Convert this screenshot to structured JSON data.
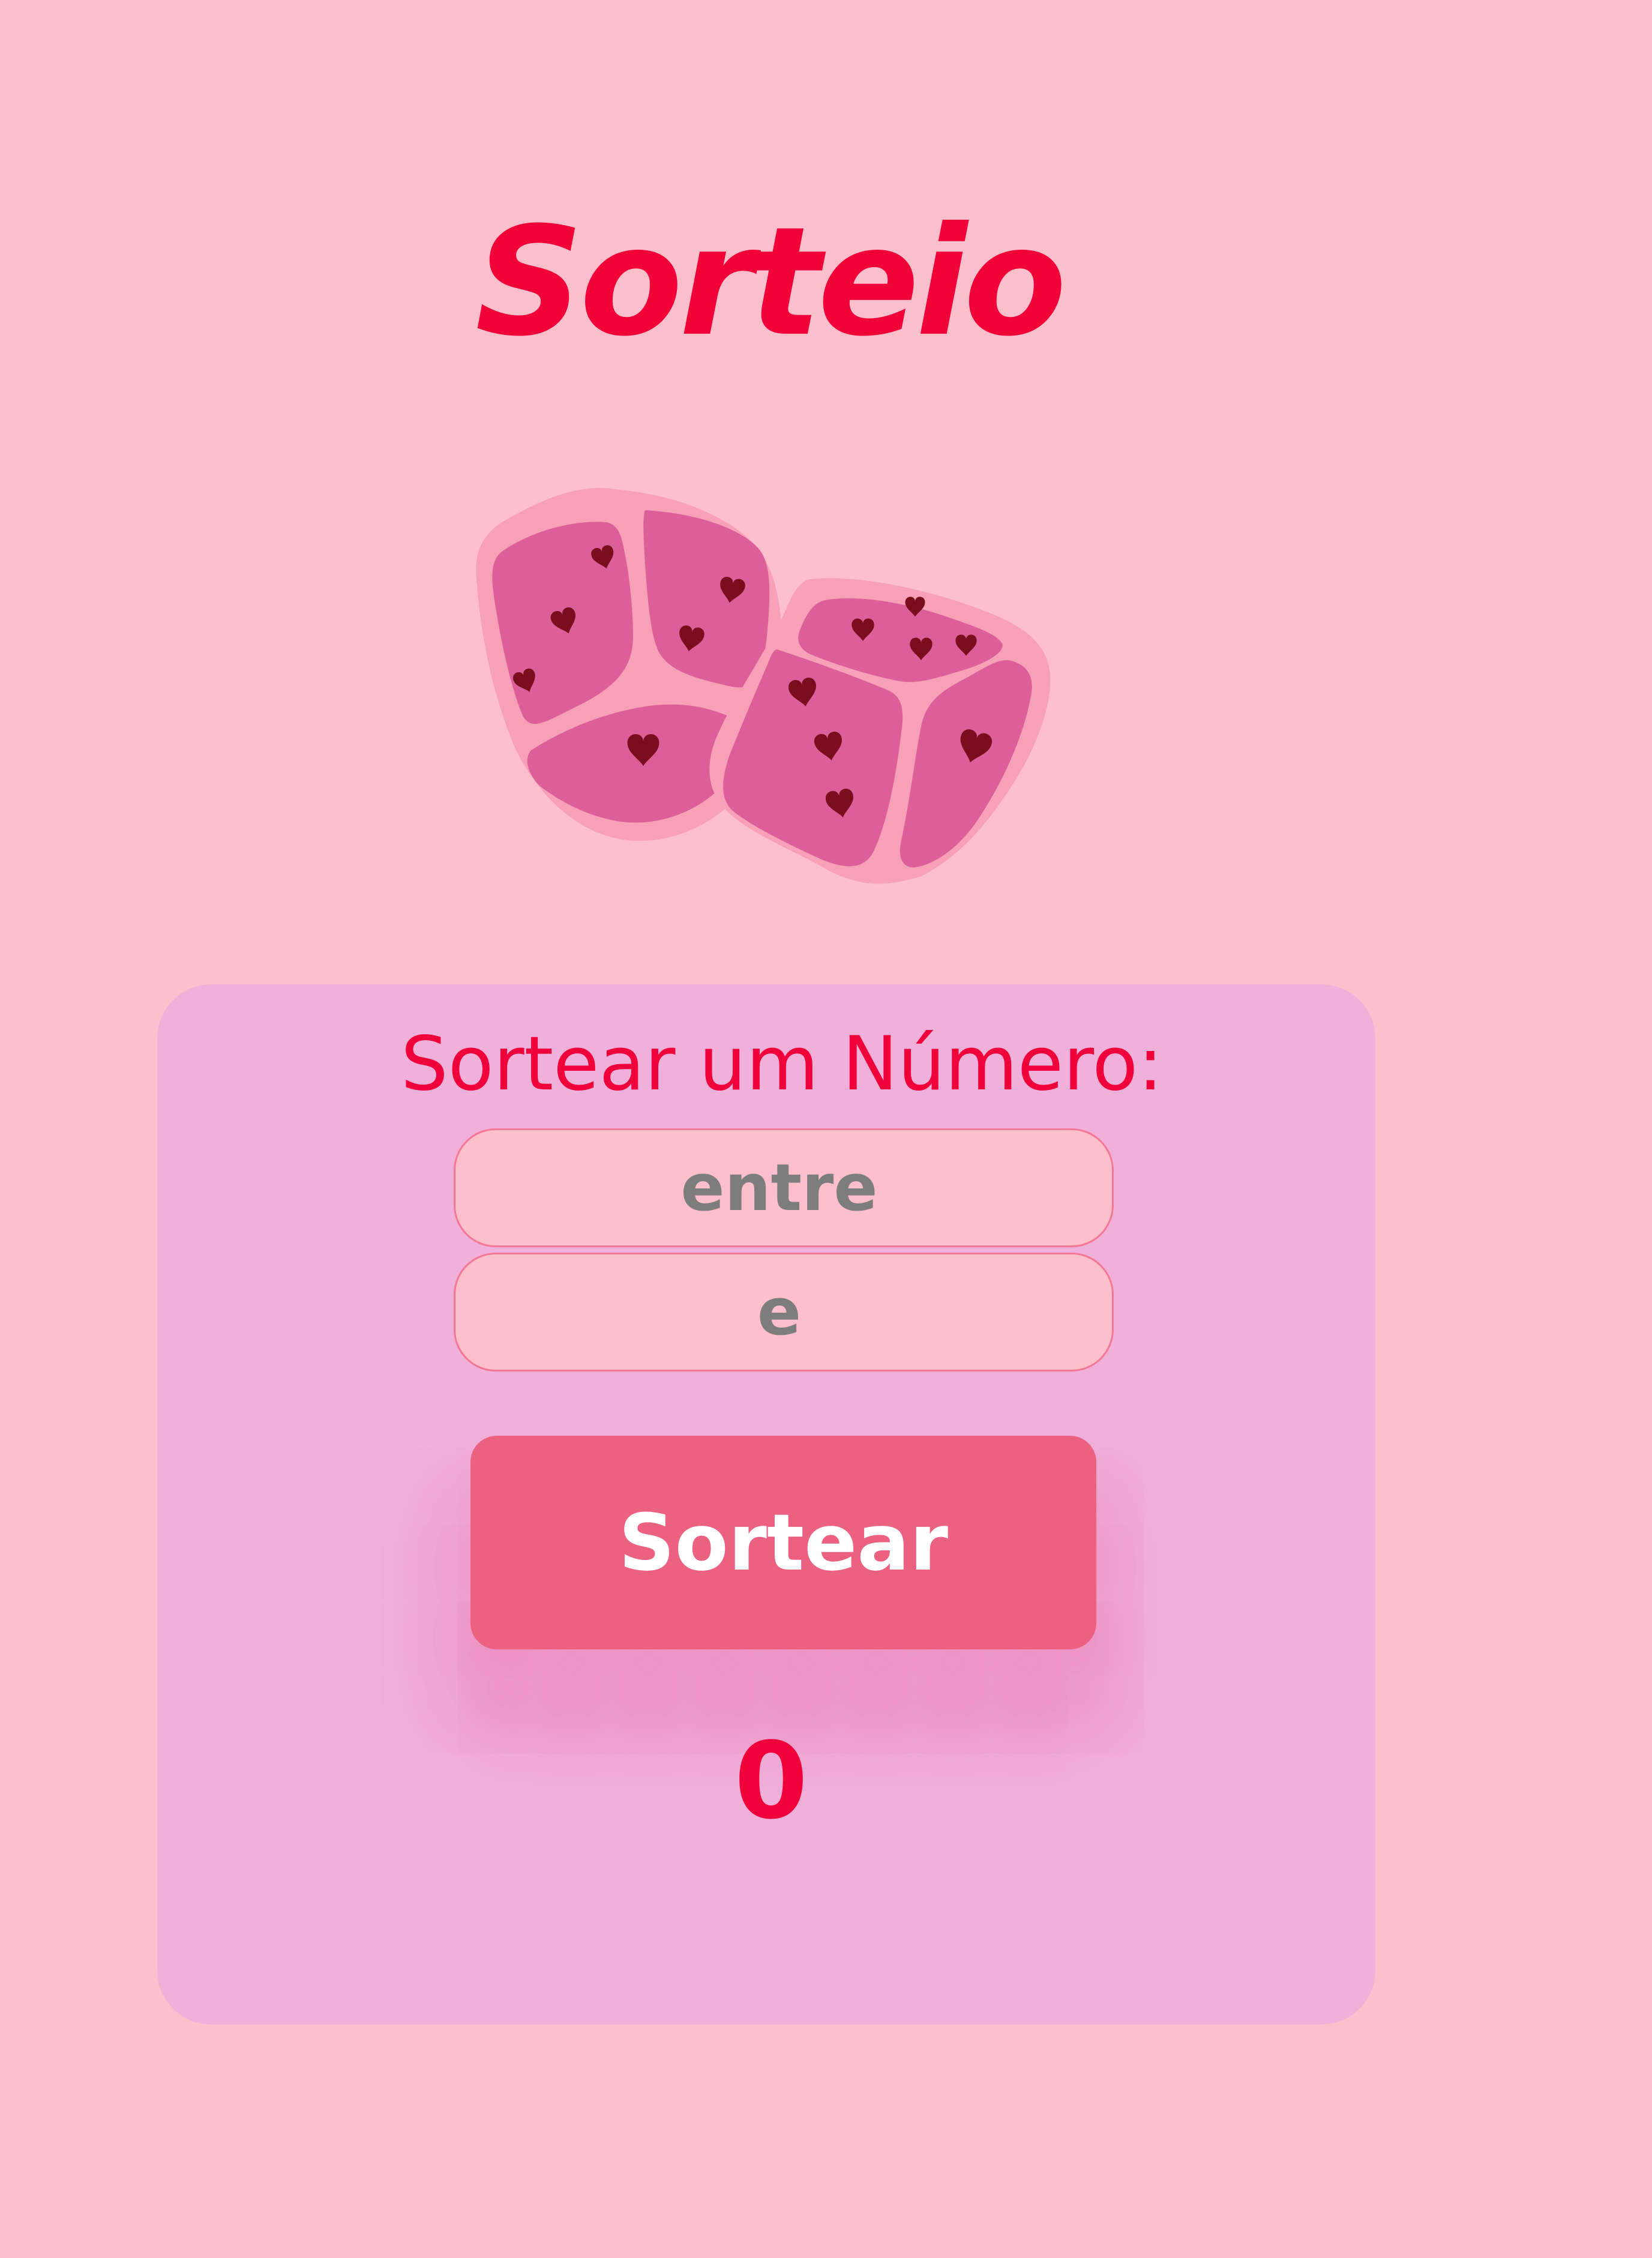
{
  "header": {
    "title": "Sorteio"
  },
  "illustration": {
    "icon": "dice-icon",
    "colors": {
      "face": "#DC5F9A",
      "edge": "#F8A0B8",
      "pip": "#7A0E1E"
    }
  },
  "panel": {
    "heading": "Sortear um Número:",
    "from_input": {
      "placeholder": "entre",
      "value": ""
    },
    "to_input": {
      "placeholder": "e",
      "value": ""
    },
    "button_label": "Sortear",
    "result": "0"
  },
  "colors": {
    "page_background": "#FDBFCC",
    "panel_background": "#F0B0DA",
    "accent": "#F0003A",
    "button": "#EC6080",
    "button_text": "#FFFFFF",
    "placeholder_text": "#7D7D7D"
  }
}
